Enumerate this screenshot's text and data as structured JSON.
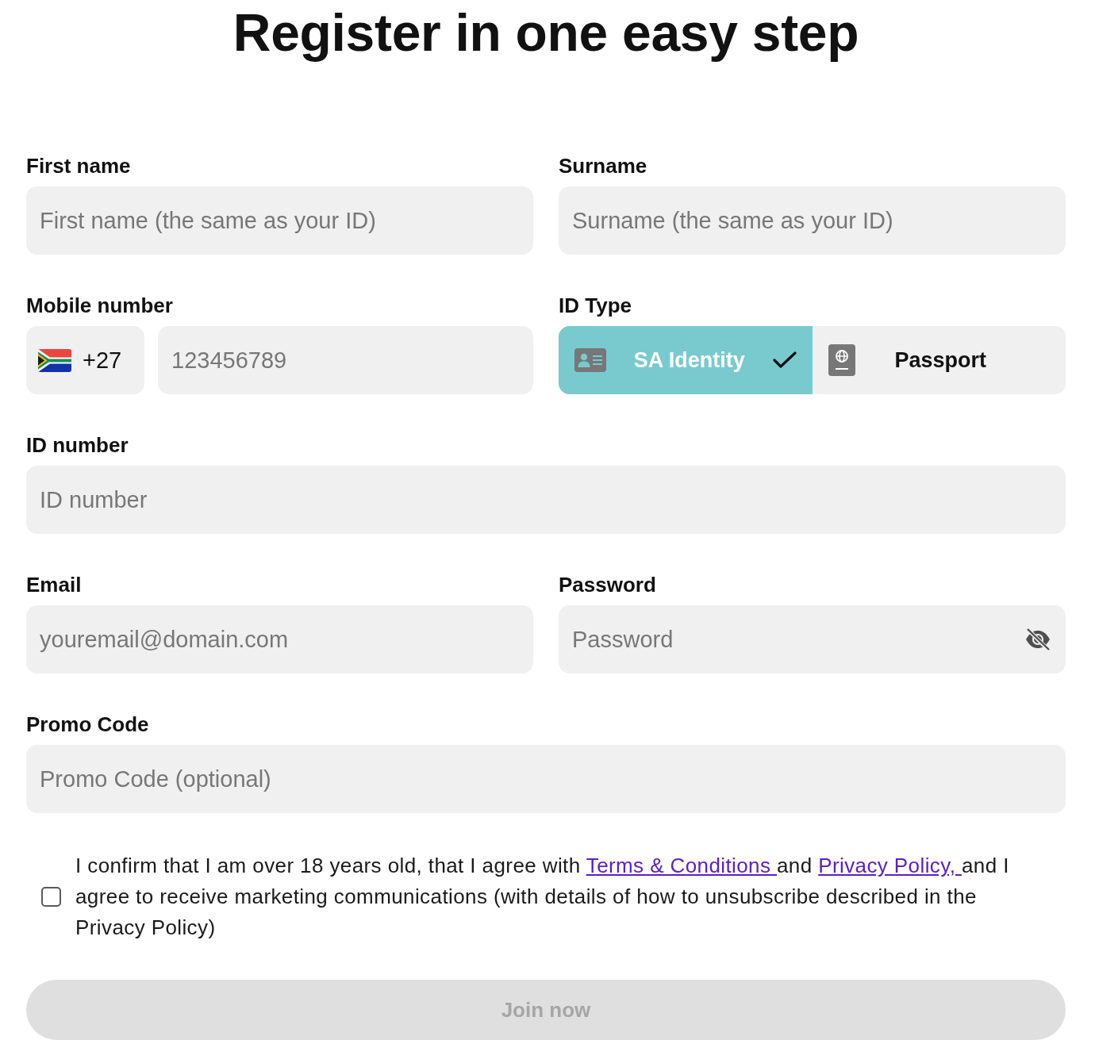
{
  "title": "Register in one easy step",
  "rows": [
    [
      {
        "kind": "text",
        "label": "First name",
        "placeholder": "First name (the same as your ID)"
      },
      {
        "kind": "text",
        "label": "Surname",
        "placeholder": "Surname (the same as your ID)"
      }
    ],
    [
      {
        "kind": "phone",
        "label": "Mobile number",
        "country_code": "+27",
        "placeholder": "123456789"
      },
      {
        "kind": "choice",
        "label": "ID Type",
        "options": [
          {
            "label": "SA Identity",
            "selected": true
          },
          {
            "label": "Passport",
            "selected": false
          }
        ]
      }
    ],
    [
      {
        "kind": "text",
        "label": "ID number",
        "placeholder": "ID number"
      }
    ],
    [
      {
        "kind": "text",
        "label": "Email",
        "placeholder": "youremail@domain.com"
      },
      {
        "kind": "password",
        "label": "Password",
        "placeholder": "Password"
      }
    ],
    [
      {
        "kind": "text",
        "label": "Promo Code",
        "placeholder": "Promo Code (optional)"
      }
    ]
  ],
  "consent": {
    "checked": false,
    "parts": [
      {
        "kind": "text",
        "text": "I confirm that I am over 18 years old, that I agree with "
      },
      {
        "kind": "link",
        "text": "Terms & Conditions "
      },
      {
        "kind": "text",
        "text": "and "
      },
      {
        "kind": "link",
        "text": "Privacy Policy, "
      },
      {
        "kind": "text",
        "text": "and I agree to receive marketing communications (with details of how to unsubscribe described in the Privacy Policy)"
      }
    ]
  },
  "submit": {
    "label": "Join now",
    "disabled": true
  }
}
